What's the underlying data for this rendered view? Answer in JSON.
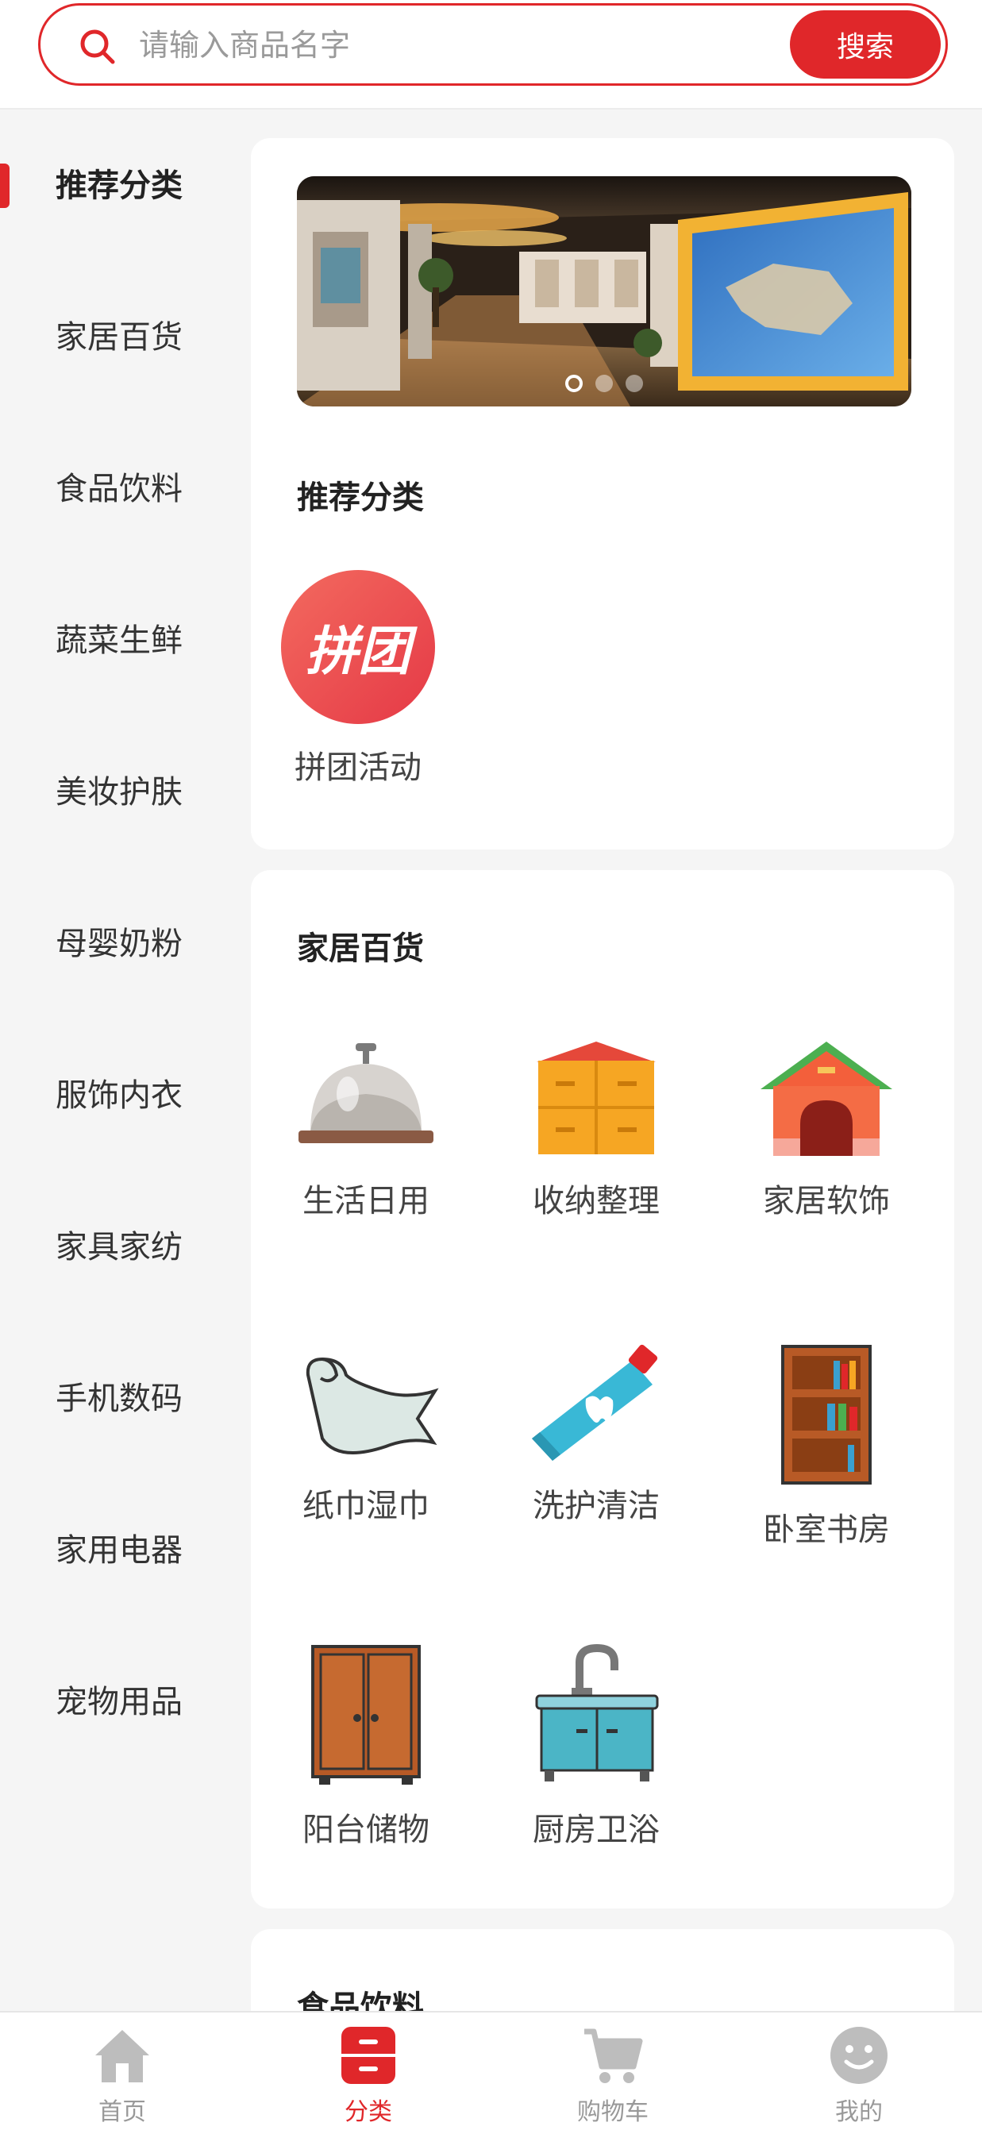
{
  "search": {
    "placeholder": "请输入商品名字",
    "button_label": "搜索"
  },
  "sidebar": {
    "items": [
      {
        "label": "推荐分类",
        "active": true
      },
      {
        "label": "家居百货"
      },
      {
        "label": "食品饮料"
      },
      {
        "label": "蔬菜生鲜"
      },
      {
        "label": "美妆护肤"
      },
      {
        "label": "母婴奶粉"
      },
      {
        "label": "服饰内衣"
      },
      {
        "label": "家具家纺"
      },
      {
        "label": "手机数码"
      },
      {
        "label": "家用电器"
      },
      {
        "label": "宠物用品"
      }
    ]
  },
  "recommend": {
    "title": "推荐分类",
    "banner_dots": 3,
    "items": [
      {
        "label": "拼团活动",
        "icon": "group-buy-icon",
        "icon_text": "拼团"
      }
    ]
  },
  "home_goods": {
    "title": "家居百货",
    "items": [
      {
        "label": "生活日用",
        "icon": "service-bell-icon"
      },
      {
        "label": "收纳整理",
        "icon": "storage-cabinet-icon"
      },
      {
        "label": "家居软饰",
        "icon": "house-icon"
      },
      {
        "label": "纸巾湿巾",
        "icon": "tissue-icon"
      },
      {
        "label": "洗护清洁",
        "icon": "toothpaste-icon"
      },
      {
        "label": "卧室书房",
        "icon": "bookshelf-icon"
      },
      {
        "label": "阳台储物",
        "icon": "wardrobe-icon"
      },
      {
        "label": "厨房卫浴",
        "icon": "sink-icon"
      }
    ]
  },
  "food": {
    "title": "食品饮料"
  },
  "tabbar": {
    "items": [
      {
        "label": "首页",
        "icon": "home-icon"
      },
      {
        "label": "分类",
        "icon": "category-icon",
        "active": true
      },
      {
        "label": "购物车",
        "icon": "cart-icon"
      },
      {
        "label": "我的",
        "icon": "profile-icon"
      }
    ]
  },
  "colors": {
    "accent": "#e0272a",
    "background": "#f5f5f5"
  }
}
